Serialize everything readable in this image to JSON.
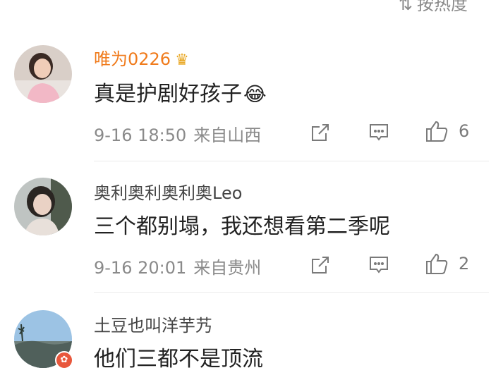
{
  "sort": {
    "label": "按热度",
    "icon": "sort-icon"
  },
  "comments": [
    {
      "username": "唯为0226",
      "badge_icon": "crown-icon",
      "text": "真是护剧好孩子",
      "emoji": "laugh-cry-emoji",
      "time": "9-16 18:50",
      "location": "来自山西",
      "likes": "6",
      "username_color": "#f07b1c"
    },
    {
      "username": "奥利奥利奥利奥Leo",
      "text": "三个都别塌，我还想看第二季呢",
      "time": "9-16 20:01",
      "location": "来自贵州",
      "likes": "2"
    },
    {
      "username": "土豆也叫洋芋艿",
      "text": "他们三都不是顶流"
    }
  ]
}
